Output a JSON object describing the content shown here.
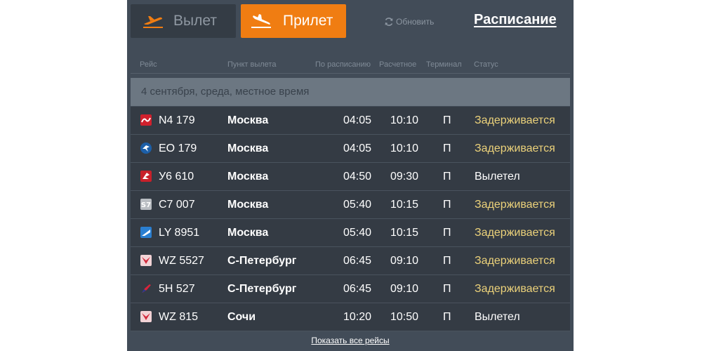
{
  "tabs": {
    "departures": "Вылет",
    "arrivals": "Прилет",
    "active": "arrivals"
  },
  "refresh_label": "Обновить",
  "schedule_link": "Расписание",
  "columns": {
    "flight": "Рейс",
    "origin": "Пункт вылета",
    "scheduled": "По расписанию",
    "estimated": "Расчетное",
    "terminal": "Терминал",
    "status": "Статус"
  },
  "date_band": "4 сентября, среда, местное время",
  "flights": [
    {
      "flight": "N4 179",
      "origin": "Москва",
      "scheduled": "04:05",
      "estimated": "10:10",
      "terminal": "П",
      "status": "Задерживается",
      "status_kind": "delayed",
      "logo": "nordwind-logo-icon"
    },
    {
      "flight": "EO 179",
      "origin": "Москва",
      "scheduled": "04:05",
      "estimated": "10:10",
      "terminal": "П",
      "status": "Задерживается",
      "status_kind": "delayed",
      "logo": "pegas-fly-logo-icon"
    },
    {
      "flight": "У6 610",
      "origin": "Москва",
      "scheduled": "04:50",
      "estimated": "09:30",
      "terminal": "П",
      "status": "Вылетел",
      "status_kind": "departed",
      "logo": "ural-airlines-logo-icon"
    },
    {
      "flight": "С7 007",
      "origin": "Москва",
      "scheduled": "05:40",
      "estimated": "10:15",
      "terminal": "П",
      "status": "Задерживается",
      "status_kind": "delayed",
      "logo": "s7-logo-icon"
    },
    {
      "flight": "LY 8951",
      "origin": "Москва",
      "scheduled": "05:40",
      "estimated": "10:15",
      "terminal": "П",
      "status": "Задерживается",
      "status_kind": "delayed",
      "logo": "el-al-logo-icon"
    },
    {
      "flight": "WZ 5527",
      "origin": "С-Петербург",
      "scheduled": "06:45",
      "estimated": "09:10",
      "terminal": "П",
      "status": "Задерживается",
      "status_kind": "delayed",
      "logo": "red-wings-logo-icon"
    },
    {
      "flight": "5H 527",
      "origin": "С-Петербург",
      "scheduled": "06:45",
      "estimated": "09:10",
      "terminal": "П",
      "status": "Задерживается",
      "status_kind": "delayed",
      "logo": "five-stars-logo-icon"
    },
    {
      "flight": "WZ 815",
      "origin": "Сочи",
      "scheduled": "10:20",
      "estimated": "10:50",
      "terminal": "П",
      "status": "Вылетел",
      "status_kind": "departed",
      "logo": "red-wings-logo-icon"
    }
  ],
  "show_all_label": "Показать все рейсы",
  "colors": {
    "board_bg": "#424c58",
    "active_tab": "#f07d12",
    "delayed": "#ecd27a"
  }
}
